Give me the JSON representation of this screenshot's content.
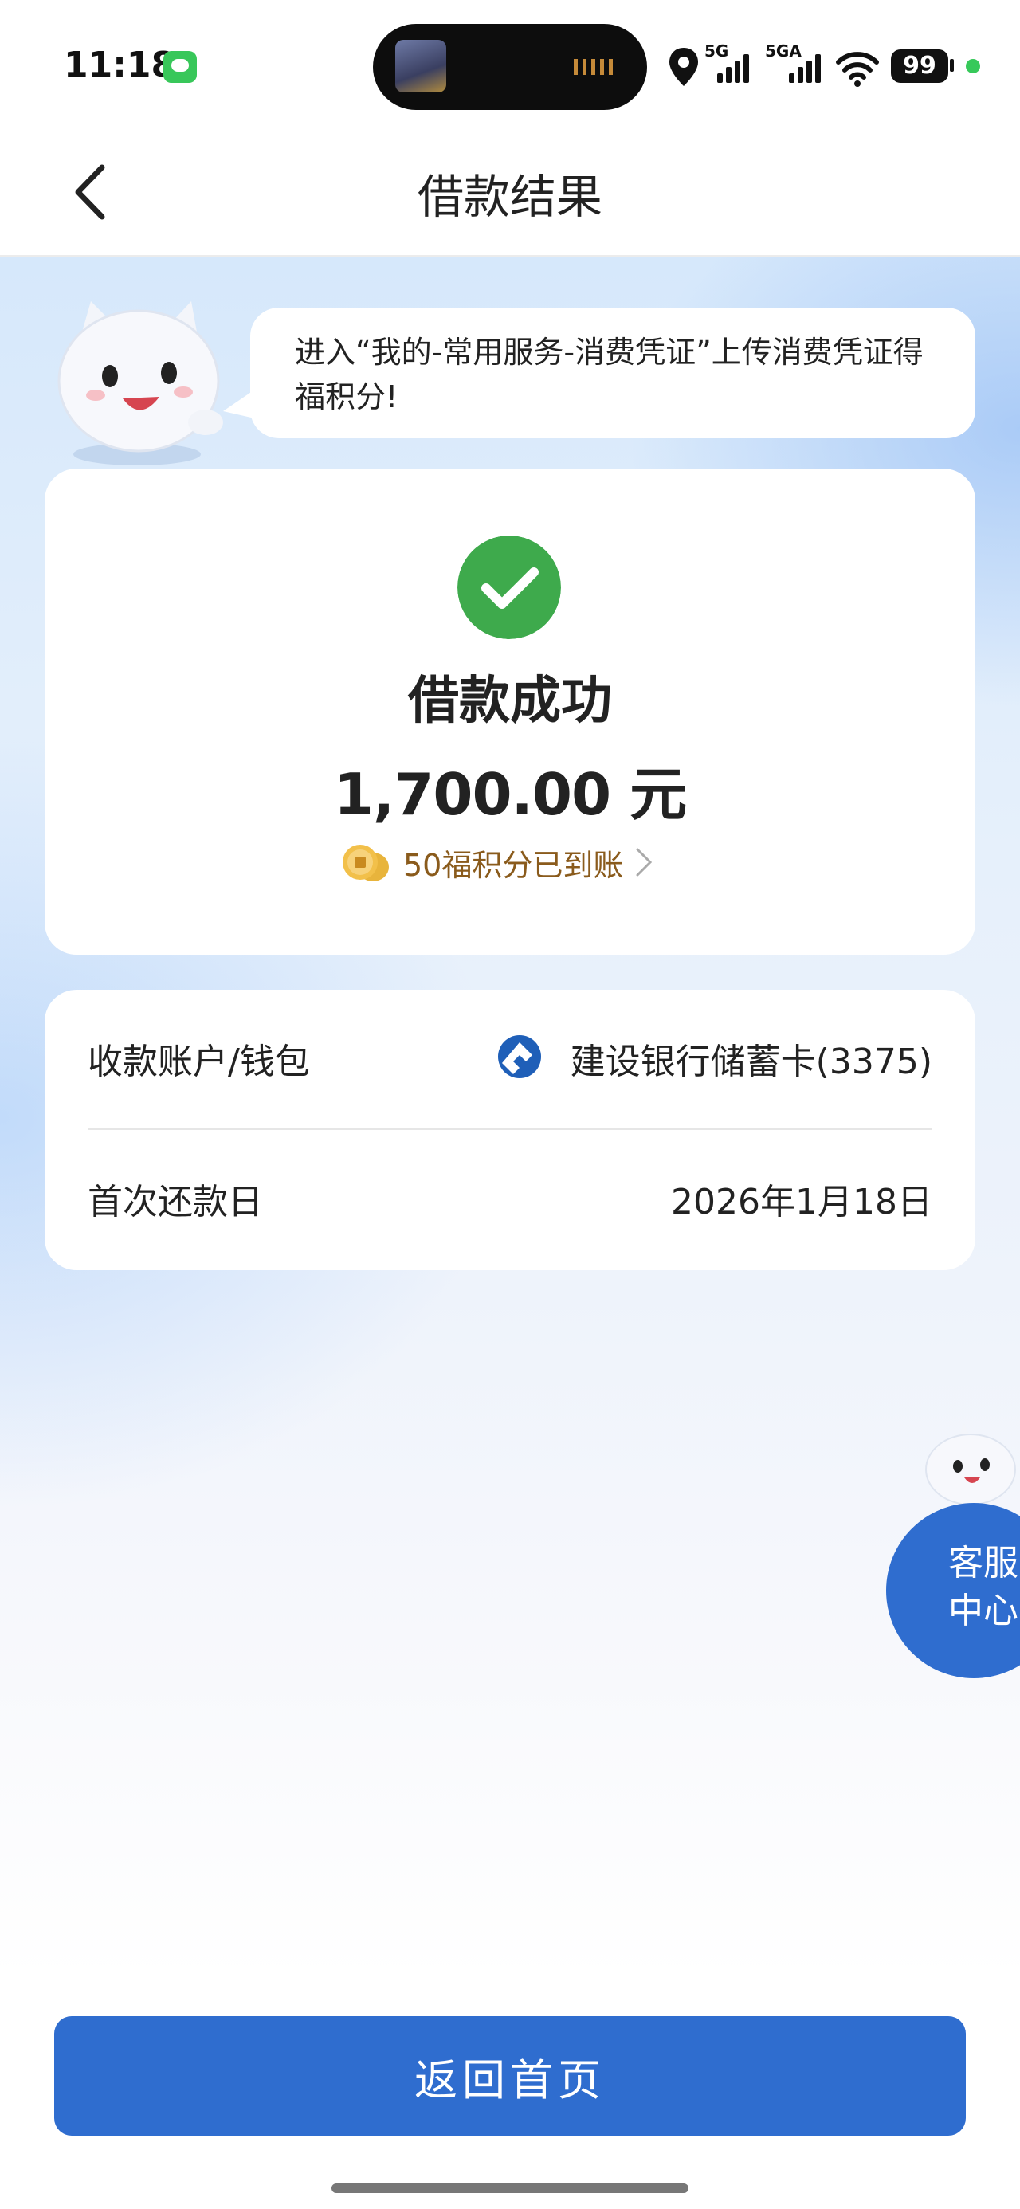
{
  "status_bar": {
    "time": "11:18",
    "network_1": "5G",
    "network_2": "5GA",
    "battery": "99"
  },
  "nav": {
    "title": "借款结果"
  },
  "tip": {
    "text": "进入“我的-常用服务-消费凭证”上传消费凭证得福积分!"
  },
  "result": {
    "title": "借款成功",
    "amount": "1,700.00 元",
    "points_text": "50福积分已到账",
    "success_color": "#3eaa4c"
  },
  "info": {
    "rows": [
      {
        "label": "收款账户/钱包",
        "value": "建设银行储蓄卡(3375)"
      },
      {
        "label": "首次还款日",
        "value": "2026年1月18日"
      }
    ]
  },
  "customer_service": {
    "label": "客服中心"
  },
  "footer": {
    "home_button": "返回首页",
    "accent_color": "#2f6dcf"
  }
}
